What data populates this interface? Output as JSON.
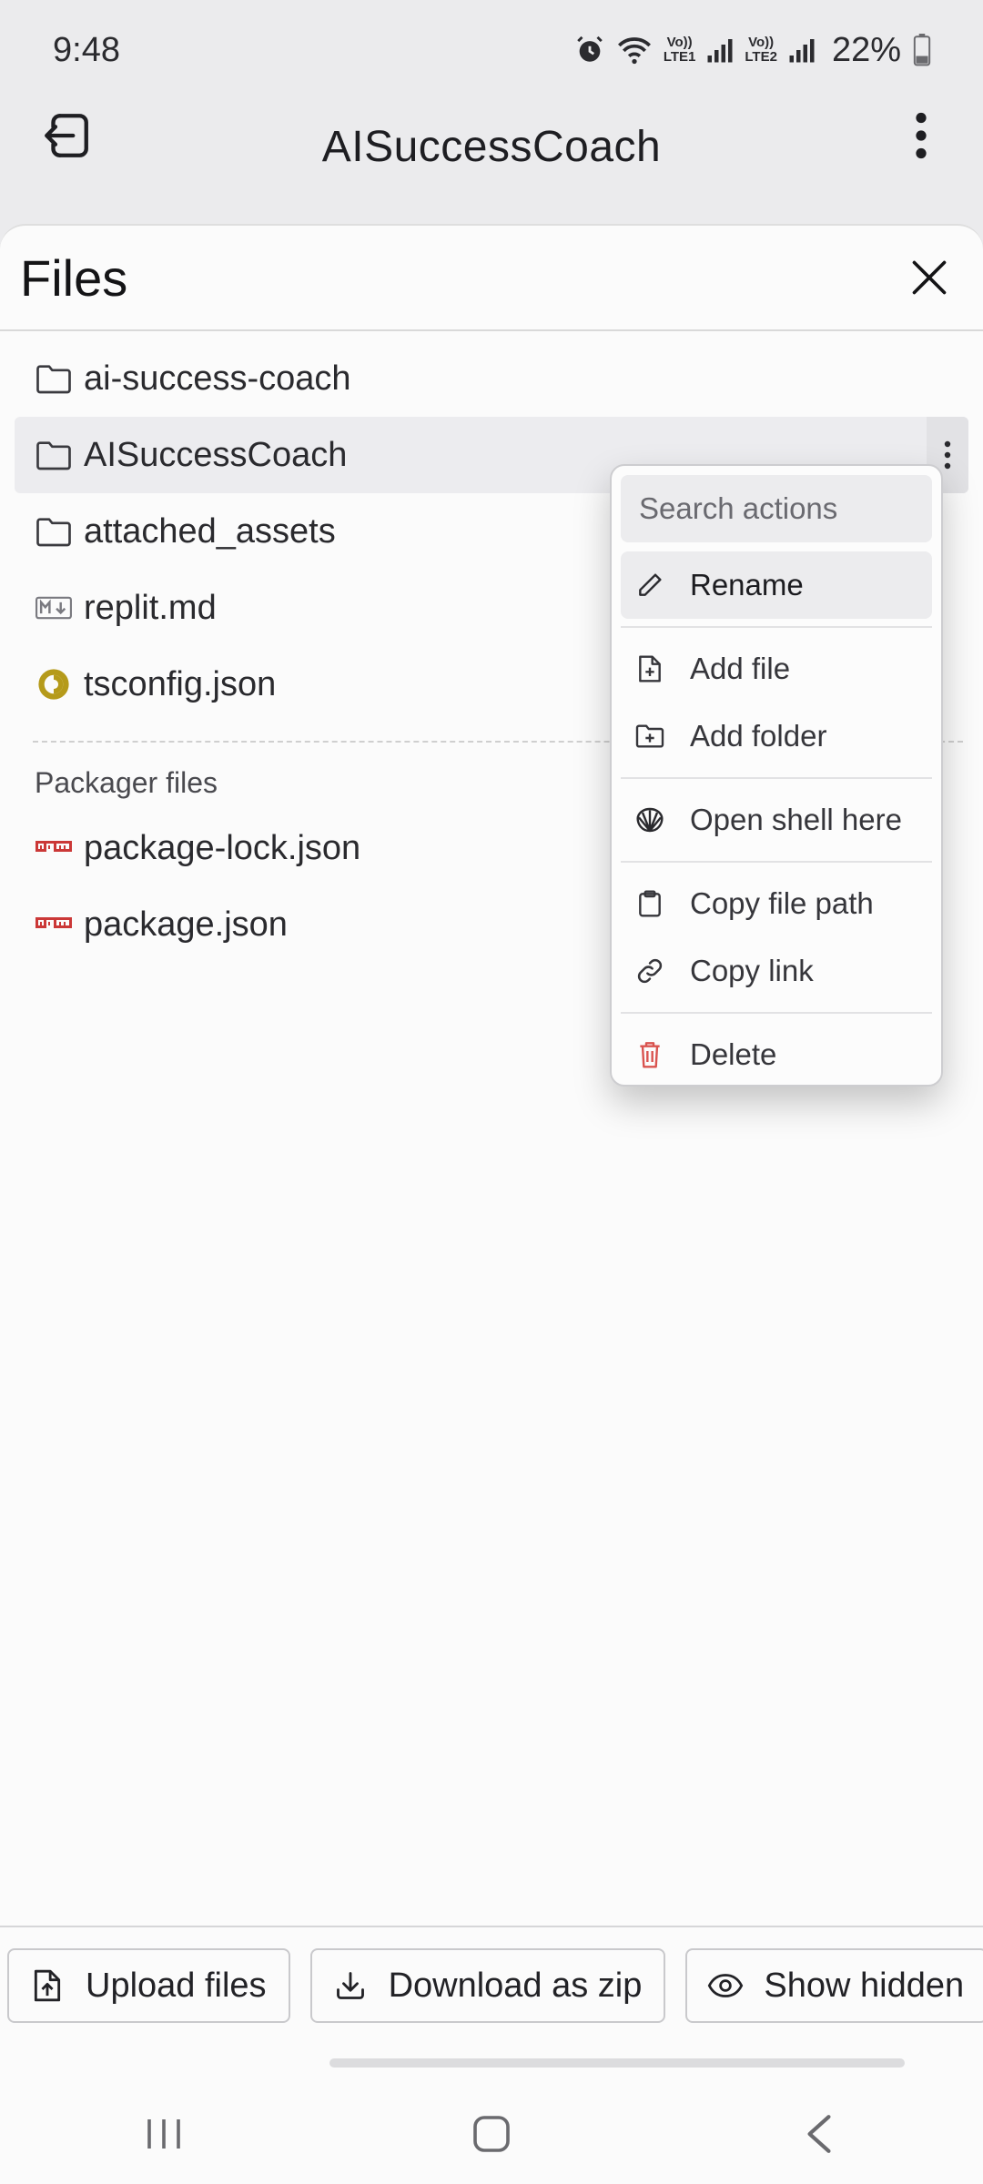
{
  "status_bar": {
    "time": "9:48",
    "lte1": "LTE1",
    "lte2": "LTE2",
    "volte": "Vo))",
    "battery_percent": "22%",
    "icons": [
      "alarm-icon",
      "wifi-icon",
      "signal-icon",
      "signal-icon",
      "battery-icon"
    ]
  },
  "header": {
    "title": "AISuccessCoach",
    "back_icon": "exit-icon",
    "menu_icon": "more-vertical-icon"
  },
  "files_panel": {
    "title": "Files",
    "close_icon": "close-icon",
    "items": [
      {
        "label": "ai-success-coach",
        "icon": "folder-icon"
      },
      {
        "label": "AISuccessCoach",
        "icon": "folder-icon",
        "selected": true
      },
      {
        "label": "attached_assets",
        "icon": "folder-icon"
      },
      {
        "label": "replit.md",
        "icon": "markdown-icon"
      },
      {
        "label": "tsconfig.json",
        "icon": "tsconfig-icon"
      }
    ],
    "packager_section_label": "Packager files",
    "packager_items": [
      {
        "label": "package-lock.json",
        "icon": "npm-icon"
      },
      {
        "label": "package.json",
        "icon": "npm-icon"
      }
    ]
  },
  "context_menu": {
    "search_placeholder": "Search actions",
    "items": [
      {
        "label": "Rename",
        "icon": "pencil-icon"
      },
      {
        "label": "Add file",
        "icon": "file-plus-icon"
      },
      {
        "label": "Add folder",
        "icon": "folder-plus-icon"
      },
      {
        "label": "Open shell here",
        "icon": "shell-icon"
      },
      {
        "label": "Copy file path",
        "icon": "clipboard-icon"
      },
      {
        "label": "Copy link",
        "icon": "link-icon"
      },
      {
        "label": "Delete",
        "icon": "trash-icon"
      }
    ],
    "danger_color": "#d9534f"
  },
  "bottom_bar": {
    "upload_label": "Upload files",
    "download_label": "Download as zip",
    "show_hidden_label": "Show hidden"
  },
  "colors": {
    "background": "#ebebed",
    "panel": "#fbfbfb",
    "npm_red": "#cb3837",
    "tsconfig_gold": "#b59a1a"
  }
}
